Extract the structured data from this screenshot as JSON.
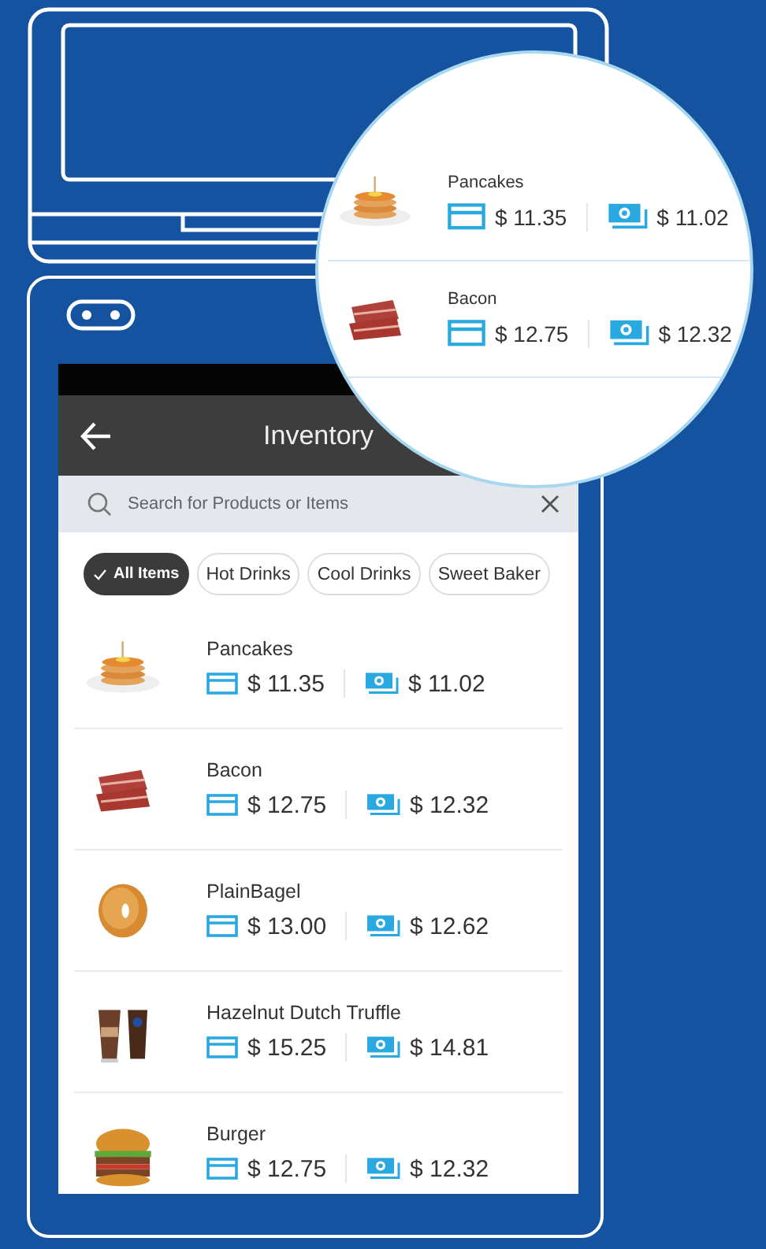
{
  "screen": {
    "title": "Inventory",
    "search": {
      "placeholder": "Search for Products or Items"
    },
    "filters": [
      {
        "label": "All Items",
        "selected": true
      },
      {
        "label": "Hot Drinks",
        "selected": false
      },
      {
        "label": "Cool Drinks",
        "selected": false
      },
      {
        "label": "Sweet Baker",
        "selected": false
      }
    ],
    "products": [
      {
        "name": "Pancakes",
        "card_price": "$ 11.35",
        "cash_price": "$ 11.02"
      },
      {
        "name": "Bacon",
        "card_price": "$ 12.75",
        "cash_price": "$ 12.32"
      },
      {
        "name": "PlainBagel",
        "card_price": "$ 13.00",
        "cash_price": "$ 12.62"
      },
      {
        "name": "Hazelnut Dutch Truffle",
        "card_price": "$ 15.25",
        "cash_price": "$ 14.81"
      },
      {
        "name": "Burger",
        "card_price": "$ 12.75",
        "cash_price": "$ 12.32"
      }
    ]
  },
  "magnifier": {
    "products": [
      {
        "name": "Pancakes",
        "card_price": "$ 11.35",
        "cash_price": "$ 11.02"
      },
      {
        "name": "Bacon",
        "card_price": "$ 12.75",
        "cash_price": "$ 12.32"
      }
    ]
  }
}
